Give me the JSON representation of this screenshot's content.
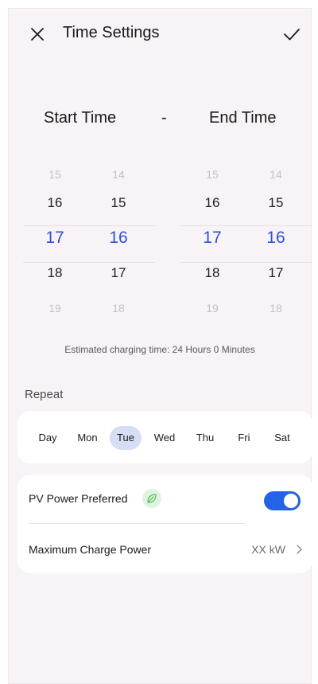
{
  "header": {
    "title": "Time Settings",
    "close_icon": "close-icon",
    "confirm_icon": "check-icon"
  },
  "labels": {
    "start": "Start Time",
    "separator": "-",
    "end": "End Time"
  },
  "start_picker": {
    "hours": [
      "15",
      "16",
      "17",
      "18",
      "19"
    ],
    "minutes": [
      "14",
      "15",
      "16",
      "17",
      "18"
    ],
    "selected_hour": "17",
    "selected_minute": "16"
  },
  "end_picker": {
    "hours": [
      "15",
      "16",
      "17",
      "18",
      "19"
    ],
    "minutes": [
      "14",
      "15",
      "16",
      "17",
      "18"
    ],
    "selected_hour": "17",
    "selected_minute": "16"
  },
  "estimate": "Estimated charging time: 24 Hours 0 Minutes",
  "repeat": {
    "title": "Repeat",
    "days": [
      "Day",
      "Mon",
      "Tue",
      "Wed",
      "Thu",
      "Fri",
      "Sat"
    ],
    "selected": "Tue"
  },
  "settings": {
    "pv_label": "PV Power Preferred",
    "pv_icon": "leaf-icon",
    "pv_enabled": true,
    "max_label": "Maximum Charge Power",
    "max_value": "XX kW"
  },
  "colors": {
    "accent": "#2f50d8",
    "toggle_on": "#2563e6",
    "selected_day_bg": "#d6def6",
    "background": "#f7f3f6"
  }
}
